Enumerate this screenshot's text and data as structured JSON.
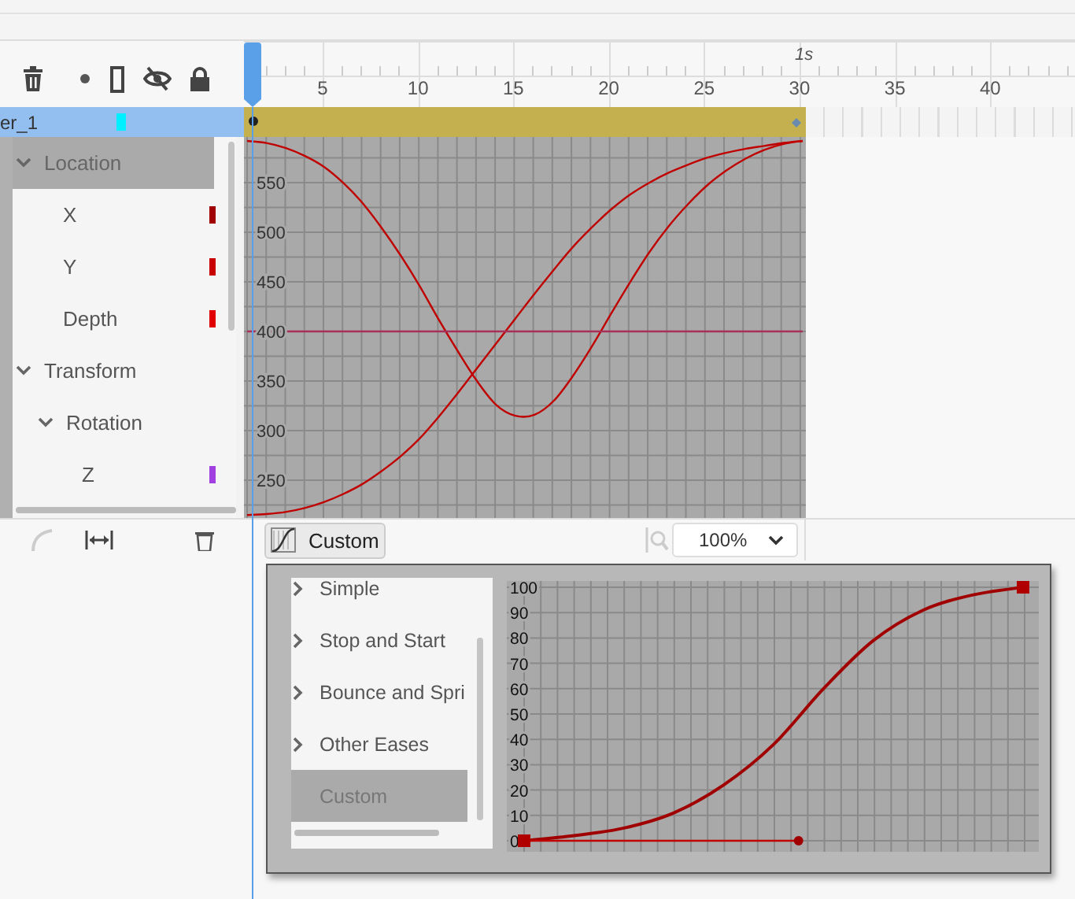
{
  "ruler": {
    "second_label": "1s",
    "marks": [
      "5",
      "10",
      "15",
      "20",
      "25",
      "30",
      "35",
      "40"
    ]
  },
  "layer": {
    "name": "er_1",
    "selected": true
  },
  "properties": [
    {
      "label": "Location",
      "expanded": true,
      "selected": true,
      "children": [
        {
          "label": "X",
          "selected": false,
          "color": "#a00000"
        },
        {
          "label": "Y",
          "selected": false,
          "color": "#c80000"
        },
        {
          "label": "Depth",
          "selected": false,
          "color": "#e00000"
        }
      ]
    },
    {
      "label": "Transform",
      "expanded": true,
      "selected": false,
      "children": [
        {
          "label": "Rotation",
          "expanded": true,
          "selected": false,
          "children": [
            {
              "label": "Z",
              "selected": false,
              "color": "#a040e0"
            }
          ]
        }
      ]
    }
  ],
  "graph": {
    "chart_data": {
      "type": "line",
      "grid": true,
      "ylim": [
        212,
        596
      ],
      "yticks": [
        250,
        300,
        350,
        400,
        450,
        500,
        550
      ],
      "series": [
        {
          "color": "#c00000",
          "values": [
            592,
            590,
            585,
            577,
            566,
            550,
            530,
            505,
            477,
            446,
            412,
            380,
            350,
            326,
            315,
            316,
            330,
            355,
            385,
            418,
            450,
            480,
            506,
            528,
            547,
            562,
            574,
            583,
            589,
            592
          ]
        },
        {
          "color": "#c00000",
          "values": [
            215,
            216,
            218,
            222,
            228,
            236,
            246,
            259,
            274,
            292,
            314,
            338,
            363,
            388,
            413,
            438,
            462,
            485,
            505,
            523,
            538,
            550,
            560,
            568,
            575,
            580,
            584,
            587,
            590,
            592
          ]
        },
        {
          "color": "#a8305a",
          "values": [
            400,
            400,
            400,
            400,
            400,
            400,
            400,
            400,
            400,
            400,
            400,
            400,
            400,
            400,
            400,
            400,
            400,
            400,
            400,
            400,
            400,
            400,
            400,
            400,
            400,
            400,
            400,
            400,
            400,
            400
          ]
        }
      ]
    }
  },
  "ease_button": {
    "label": "Custom"
  },
  "zoom": {
    "value": "100%"
  },
  "ease_presets": {
    "items": [
      {
        "label": "Simple",
        "kind": "group",
        "expanded": false,
        "selected": false
      },
      {
        "label": "Stop and Start",
        "kind": "group",
        "expanded": false,
        "selected": false
      },
      {
        "label": "Bounce and Spri",
        "kind": "group",
        "expanded": false,
        "selected": false
      },
      {
        "label": "Other Eases",
        "kind": "group",
        "expanded": false,
        "selected": false
      },
      {
        "label": "Custom",
        "kind": "item",
        "selected": true
      }
    ],
    "chart_data": {
      "type": "line",
      "grid": true,
      "ylim": [
        0,
        100
      ],
      "yticks": [
        0,
        10,
        20,
        30,
        40,
        50,
        60,
        70,
        80,
        90,
        100
      ],
      "series": [
        {
          "color": "#a00000",
          "values": [
            0,
            2,
            5,
            11,
            22,
            38,
            60,
            79,
            91,
            97,
            100
          ]
        }
      ]
    }
  }
}
